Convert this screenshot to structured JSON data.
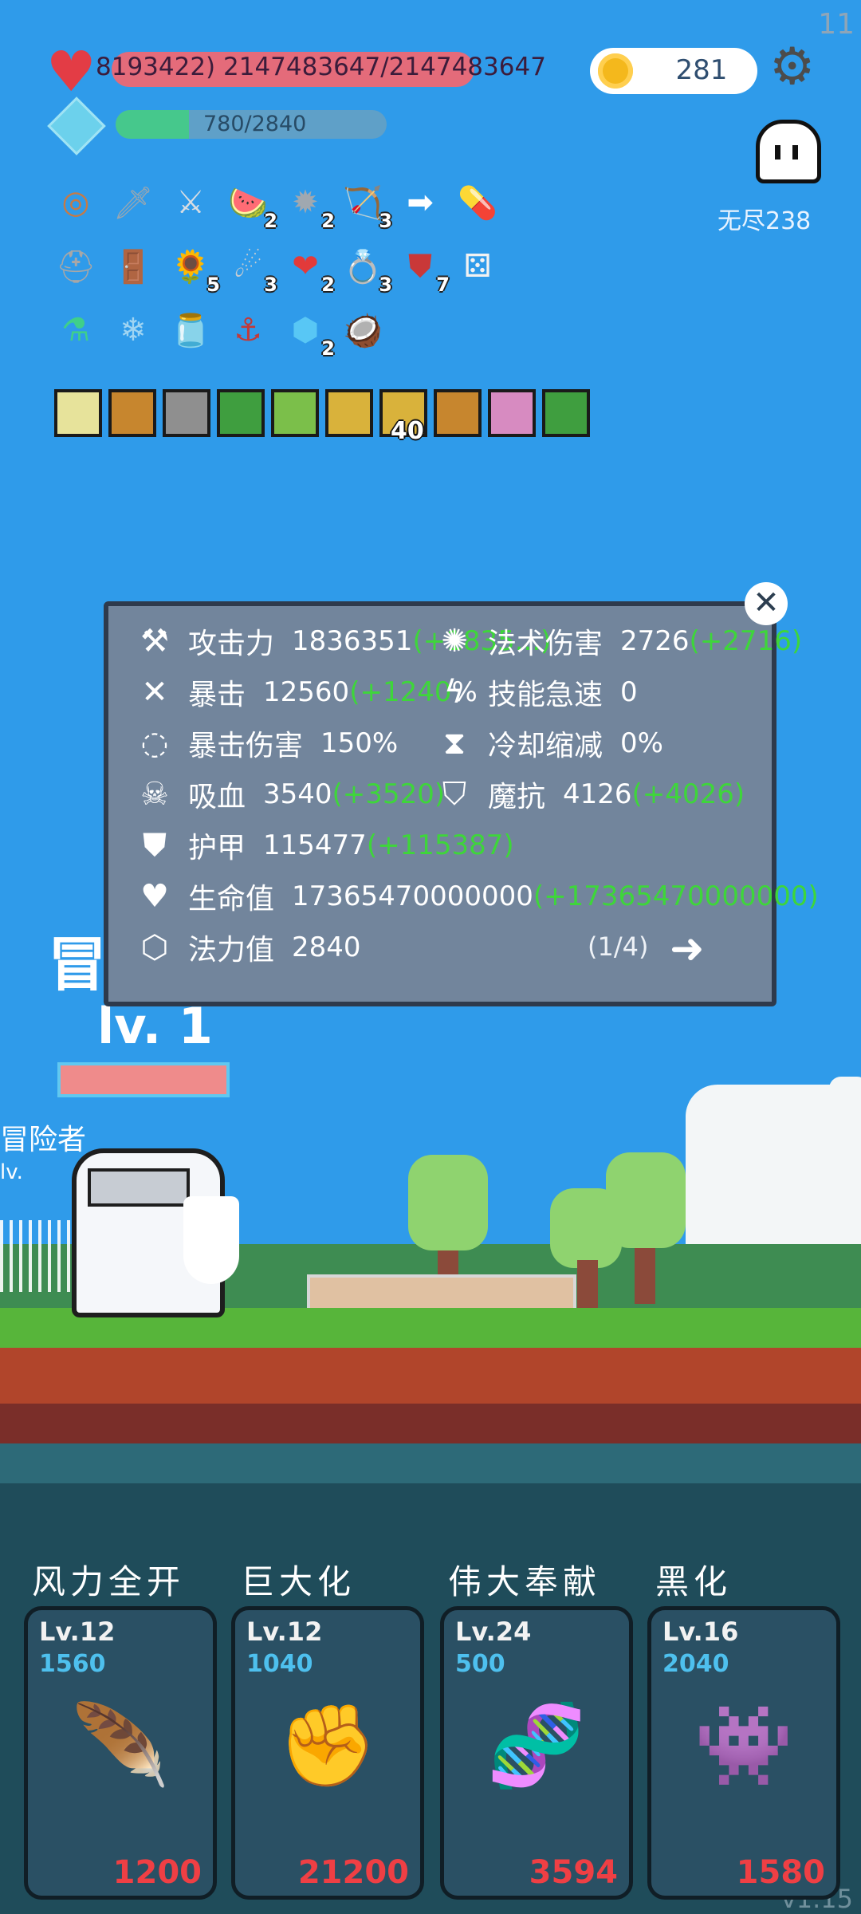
{
  "hud": {
    "hp_text": "8193422) 2147483647/2147483647",
    "mp_text": "780/2840",
    "mp_fill": 0.27,
    "coins": "281",
    "endless": "无尽238",
    "corner_number": "11",
    "version": "v1.15"
  },
  "items": {
    "row1": [
      {
        "icon": "shield-round-icon",
        "glyph": "◎",
        "color": "#c77a45"
      },
      {
        "icon": "sword-icon",
        "glyph": "🗡",
        "color": "#9ba7b0"
      },
      {
        "icon": "long-sword-icon",
        "glyph": "⚔",
        "color": "#d8dde3"
      },
      {
        "icon": "watermelon-icon",
        "glyph": "🍉",
        "color": "#e75a58",
        "badge": "2"
      },
      {
        "icon": "spiked-mace-icon",
        "glyph": "✹",
        "color": "#a0a8b0",
        "badge": "2"
      },
      {
        "icon": "bow-icon",
        "glyph": "🏹",
        "color": "#7a5a2a",
        "badge": "3"
      },
      {
        "icon": "arrow-icon",
        "glyph": "➡",
        "color": "#ffffff"
      },
      {
        "icon": "pill-icon",
        "glyph": "💊",
        "color": "#e84a4a"
      }
    ],
    "row2": [
      {
        "icon": "viking-helmet-icon",
        "glyph": "⛑",
        "color": "#a7a7a7"
      },
      {
        "icon": "door-icon",
        "glyph": "🚪",
        "color": "#9a5a44"
      },
      {
        "icon": "sunflower-icon",
        "glyph": "🌻",
        "color": "#f1c21b",
        "badge": "5"
      },
      {
        "icon": "meteor-icon",
        "glyph": "☄",
        "color": "#c9ccd0",
        "badge": "3"
      },
      {
        "icon": "heart-bundle-icon",
        "glyph": "❤",
        "color": "#e23a3a",
        "badge": "2"
      },
      {
        "icon": "gold-ring-icon",
        "glyph": "💍",
        "color": "#f2c93a",
        "badge": "3"
      },
      {
        "icon": "red-shield-icon",
        "glyph": "⛊",
        "color": "#c93838",
        "badge": "7"
      },
      {
        "icon": "dice-icon",
        "glyph": "⚄",
        "color": "#f2f2f2"
      }
    ],
    "row3": [
      {
        "icon": "green-potion-icon",
        "glyph": "⚗",
        "color": "#3fcf8a"
      },
      {
        "icon": "frost-orb-icon",
        "glyph": "❄",
        "color": "#9fd4f2"
      },
      {
        "icon": "jam-jar-icon",
        "glyph": "🫙",
        "color": "#d9415c"
      },
      {
        "icon": "hook-icon",
        "glyph": "⚓",
        "color": "#c23a3a"
      },
      {
        "icon": "blue-gem-icon",
        "glyph": "⬢",
        "color": "#58c7f5",
        "badge": "2"
      },
      {
        "icon": "coconut-icon",
        "glyph": "🥥",
        "color": "#8a5a3a"
      }
    ]
  },
  "buffs": [
    {
      "icon": "light-buff-icon",
      "color": "#e7e39b"
    },
    {
      "icon": "shield-buff-icon",
      "color": "#c7862e"
    },
    {
      "icon": "helmet-buff-icon",
      "color": "#8f8f8f"
    },
    {
      "icon": "green-rune-buff-icon",
      "color": "#3f9e3f"
    },
    {
      "icon": "sprout-buff-icon",
      "color": "#7bbf4a"
    },
    {
      "icon": "dark-face-buff-icon",
      "color": "#d9b23b"
    },
    {
      "icon": "dark-face-buff-icon",
      "color": "#d9b23b",
      "badge": "40"
    },
    {
      "icon": "shield-buff-icon",
      "color": "#c7862e"
    },
    {
      "icon": "pink-creature-buff-icon",
      "color": "#d78bc1"
    },
    {
      "icon": "green-rune-buff-icon",
      "color": "#3f9e3f"
    }
  ],
  "stats": {
    "attack": {
      "label": "攻击力",
      "value": "1836351",
      "bonus": "(+1835...)"
    },
    "magic_damage": {
      "label": "法术伤害",
      "value": "2726",
      "bonus": "(+2716)"
    },
    "crit": {
      "label": "暴击",
      "value": "12560",
      "bonus": "(+1240"
    },
    "crit_suffix": "%",
    "skill_haste": {
      "label": "技能急速",
      "value": "0"
    },
    "crit_damage": {
      "label": "暴击伤害",
      "value": "150%"
    },
    "cooldown": {
      "label": "冷却缩减",
      "value": "0%"
    },
    "lifesteal": {
      "label": "吸血",
      "value": "3540",
      "bonus": "(+3520)"
    },
    "magic_resist": {
      "label": "魔抗",
      "value": "4126",
      "bonus": "(+4026)"
    },
    "armor": {
      "label": "护甲",
      "value": "115477",
      "bonus": "(+115387)"
    },
    "health": {
      "label": "生命值",
      "value": "17365470000000",
      "bonus": "(+17365470000000)"
    },
    "mana": {
      "label": "法力值",
      "value": "2840"
    },
    "page": "(1/4)"
  },
  "hero": {
    "title_char": "冒",
    "level": "lv. 1",
    "name": "冒险者",
    "mini_level": "lv."
  },
  "skills": [
    {
      "name": "风力全开",
      "level": "Lv.12",
      "cost": "1560",
      "price": "1200",
      "icon": "feather-icon",
      "glyph": "🪶",
      "color": "#5e86a8"
    },
    {
      "name": "巨大化",
      "level": "Lv.12",
      "cost": "1040",
      "price": "21200",
      "icon": "fist-icon",
      "glyph": "✊",
      "color": "#d9c08e"
    },
    {
      "name": "伟大奉献",
      "level": "Lv.24",
      "cost": "500",
      "price": "3594",
      "icon": "dna-icon",
      "glyph": "🧬",
      "color": "#c23b55"
    },
    {
      "name": "黑化",
      "level": "Lv.16",
      "cost": "2040",
      "price": "1580",
      "icon": "dark-tree-monster-icon",
      "glyph": "👾",
      "color": "#3d4e5a"
    }
  ]
}
